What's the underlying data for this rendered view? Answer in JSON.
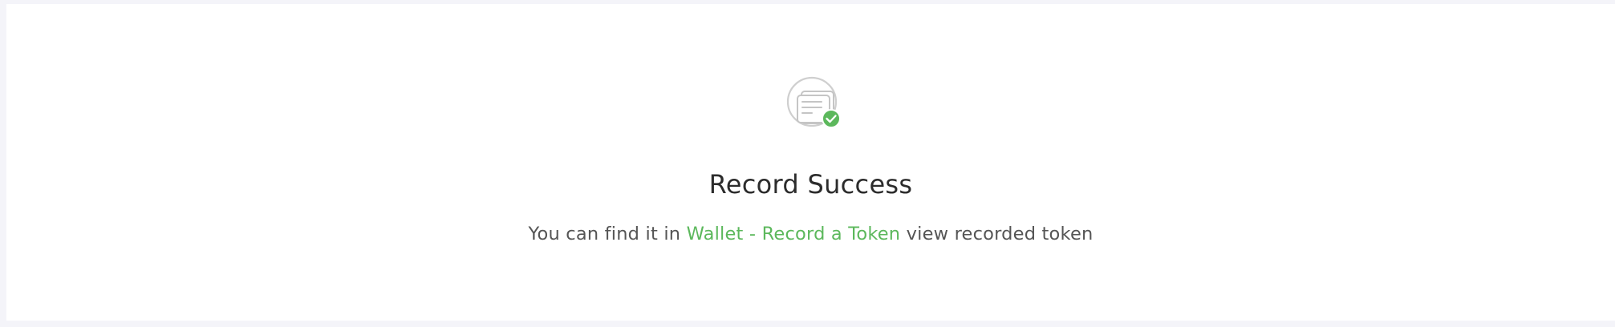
{
  "success": {
    "icon": "document-success-icon",
    "badge_icon": "check-icon",
    "accent_color": "#5cb85c",
    "title": "Record Success",
    "message_prefix": "You can find it in ",
    "wallet_link": "Wallet",
    "separator": " - ",
    "record_token_link": "Record a Token",
    "message_suffix": " view recorded token"
  }
}
